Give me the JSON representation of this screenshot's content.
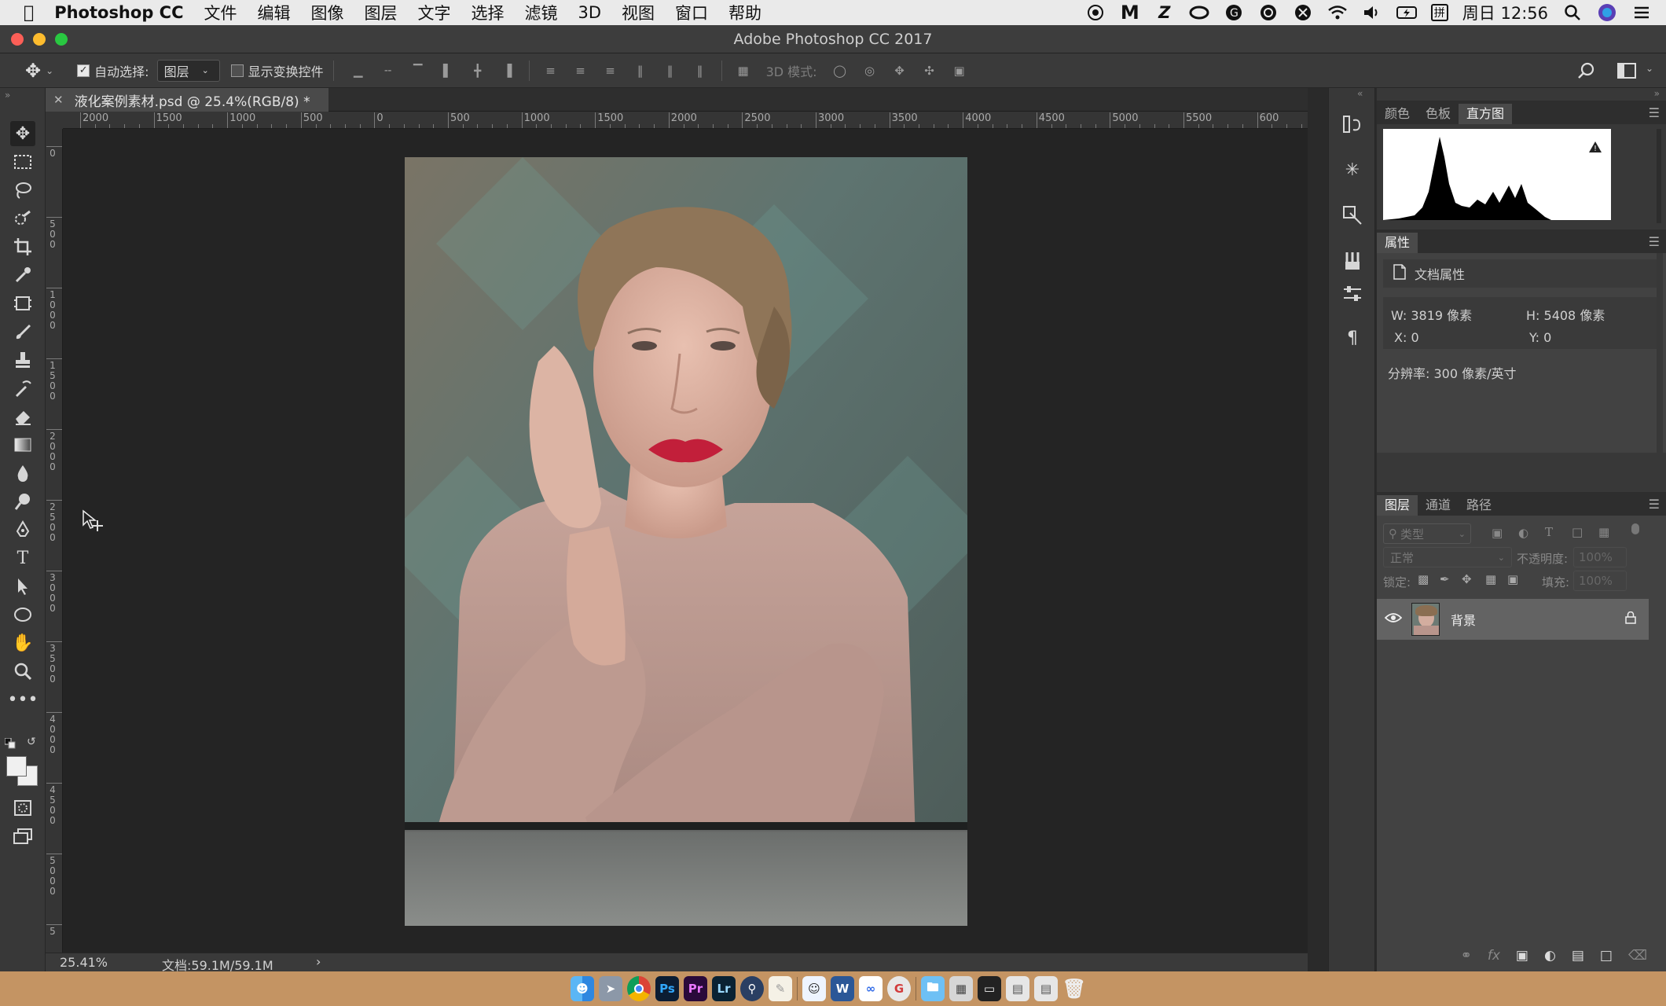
{
  "menubar": {
    "app_name": "Photoshop CC",
    "items": [
      "文件",
      "编辑",
      "图像",
      "图层",
      "文字",
      "选择",
      "滤镜",
      "3D",
      "视图",
      "窗口",
      "帮助"
    ],
    "clock": "周日 12:56",
    "input_method": "拼"
  },
  "window": {
    "title": "Adobe Photoshop CC 2017"
  },
  "options_bar": {
    "auto_select_label": "自动选择:",
    "auto_select_checked": true,
    "auto_select_value": "图层",
    "show_transform_label": "显示变换控件",
    "show_transform_checked": false,
    "mode_3d_label": "3D 模式:"
  },
  "document": {
    "tab_title": "液化案例素材.psd @ 25.4%(RGB/8) *",
    "zoom": "25.41%",
    "doc_size": "文档:59.1M/59.1M"
  },
  "rulers": {
    "h_labels": [
      "2000",
      "1500",
      "1000",
      "500",
      "0",
      "500",
      "1000",
      "1500",
      "2000",
      "2500",
      "3000",
      "3500",
      "4000",
      "4500",
      "5000",
      "5500",
      "600"
    ],
    "v_labels": [
      "0",
      "500",
      "1000",
      "1500",
      "2000",
      "2500",
      "3000",
      "3500",
      "4000",
      "4500",
      "5000",
      "5"
    ]
  },
  "panels": {
    "top_tabs": [
      "颜色",
      "色板",
      "直方图"
    ],
    "top_active": "直方图",
    "properties": {
      "title": "属性",
      "doc_props": "文档属性",
      "w": "W:  3819 像素",
      "h": "H:  5408 像素",
      "x": "X:  0",
      "y": "Y:  0",
      "resolution": "分辨率: 300 像素/英寸"
    },
    "layers": {
      "tabs": [
        "图层",
        "通道",
        "路径"
      ],
      "active": "图层",
      "filter_placeholder": "类型",
      "blend_mode": "正常",
      "opacity_label": "不透明度:",
      "opacity_value": "100%",
      "lock_label": "锁定:",
      "fill_label": "填充:",
      "fill_value": "100%",
      "items": [
        {
          "name": "背景"
        }
      ]
    }
  },
  "colors": {
    "accent_dark": "#232323",
    "panel_bg": "#383838",
    "canvas_bg": "#242424",
    "lip_red": "#c21f3a"
  }
}
